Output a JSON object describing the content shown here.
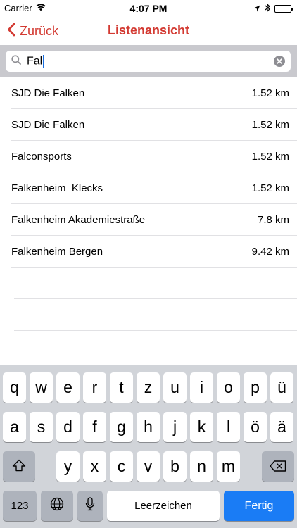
{
  "status_bar": {
    "carrier": "Carrier",
    "time": "4:07 PM"
  },
  "nav": {
    "back_label": "Zurück",
    "title": "Listenansicht",
    "accent_color": "#d33a32"
  },
  "search": {
    "value": "Fal"
  },
  "results": [
    {
      "name": "SJD Die Falken",
      "distance": "1.52 km"
    },
    {
      "name": "SJD Die Falken",
      "distance": "1.52 km"
    },
    {
      "name": "Falconsports",
      "distance": "1.52 km"
    },
    {
      "name": "Falkenheim  Klecks",
      "distance": "1.52 km"
    },
    {
      "name": "Falkenheim Akademiestraße",
      "distance": "7.8 km"
    },
    {
      "name": "Falkenheim Bergen",
      "distance": "9.42 km"
    }
  ],
  "keyboard": {
    "row1": [
      "q",
      "w",
      "e",
      "r",
      "t",
      "z",
      "u",
      "i",
      "o",
      "p",
      "ü"
    ],
    "row2": [
      "a",
      "s",
      "d",
      "f",
      "g",
      "h",
      "j",
      "k",
      "l",
      "ö",
      "ä"
    ],
    "row3": [
      "y",
      "x",
      "c",
      "v",
      "b",
      "n",
      "m"
    ],
    "numbers_label": "123",
    "space_label": "Leerzeichen",
    "return_label": "Fertig"
  }
}
